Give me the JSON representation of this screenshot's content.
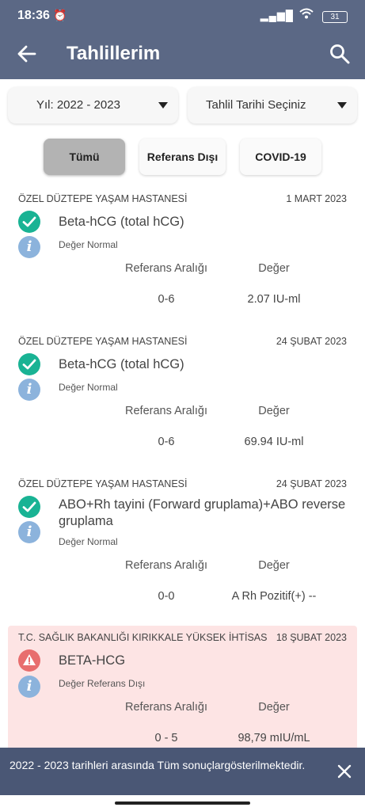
{
  "status_bar": {
    "time": "18:36",
    "battery": "31"
  },
  "app_bar": {
    "title": "Tahlillerim"
  },
  "filters": {
    "year": "Yıl: 2022 - 2023",
    "date": "Tahlil Tarihi Seçiniz"
  },
  "chips": [
    "Tümü",
    "Referans Dışı",
    "COVID-19"
  ],
  "columns": {
    "range": "Referans Aralığı",
    "value": "Değer"
  },
  "results": [
    {
      "hospital": "ÖZEL DÜZTEPE YAŞAM HASTANESİ",
      "date": "1 MART 2023",
      "test": "Beta-hCG (total hCG)",
      "status": "Değer Normal",
      "range": "0-6",
      "value": "2.07 IU-ml"
    },
    {
      "hospital": "ÖZEL DÜZTEPE YAŞAM HASTANESİ",
      "date": "24 ŞUBAT 2023",
      "test": "Beta-hCG (total hCG)",
      "status": "Değer Normal",
      "range": "0-6",
      "value": "69.94 IU-ml"
    },
    {
      "hospital": "ÖZEL DÜZTEPE YAŞAM HASTANESİ",
      "date": "24 ŞUBAT 2023",
      "test": "ABO+Rh tayini (Forward gruplama)+ABO reverse gruplama",
      "status": "Değer Normal",
      "range": "0-0",
      "value": "A Rh Pozitif(+) --"
    },
    {
      "hospital": "T.C. SAĞLIK BAKANLIĞI KIRIKKALE YÜKSEK İHTİSAS",
      "date": "18 ŞUBAT 2023",
      "test": "BETA-HCG",
      "status": "Değer Referans Dışı",
      "range": "0 - 5",
      "value": "98,79 mIU/mL"
    }
  ],
  "snackbar": {
    "message": "2022 - 2023 tarihleri arasında Tüm sonuçlargösterilmektedir."
  },
  "colors": {
    "primary": "#5b6885",
    "ok": "#19b394",
    "warn": "#e86e6e",
    "alert_bg": "#fde4e4",
    "info": "#8cb3dc"
  }
}
